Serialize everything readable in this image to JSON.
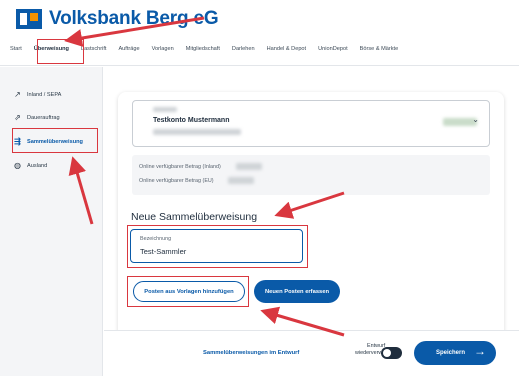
{
  "brand": {
    "name": "Volksbank Berg eG"
  },
  "nav": {
    "items": [
      "Start",
      "Überweisung",
      "Lastschrift",
      "Aufträge",
      "Vorlagen",
      "Mitgliedschaft",
      "Darlehen",
      "Handel & Depot",
      "UnionDepot",
      "Börse & Märkte"
    ],
    "active": "Überweisung"
  },
  "sidebar": {
    "items": [
      {
        "label": "Inland / SEPA",
        "icon": "arrow-up-right-icon"
      },
      {
        "label": "Dauerauftrag",
        "icon": "repeat-arrow-icon"
      },
      {
        "label": "Sammelüberweisung",
        "icon": "multi-transfer-icon"
      },
      {
        "label": "Ausland",
        "icon": "globe-icon"
      }
    ],
    "active": "Sammelüberweisung"
  },
  "account": {
    "name": "Testkonto Mustermann"
  },
  "balance": {
    "inland_label": "Online verfügbarer Betrag (Inland)",
    "eu_label": "Online verfügbarer Betrag (EU)"
  },
  "form": {
    "title": "Neue Sammelüberweisung",
    "field_label": "Bezeichnung",
    "field_value": "Test-Sammler"
  },
  "buttons": {
    "from_templates": "Posten aus Vorlagen hinzufügen",
    "new_item": "Neuen Posten erfassen"
  },
  "footer": {
    "drafts_link": "Sammelüberweisungen im Entwurf",
    "reuse_line1": "Entwurf",
    "reuse_line2": "wiederverwenden",
    "save": "Speichern"
  },
  "colors": {
    "brand_blue": "#0a5aa8",
    "brand_orange": "#f39200",
    "annotation_red": "#d9373f"
  }
}
